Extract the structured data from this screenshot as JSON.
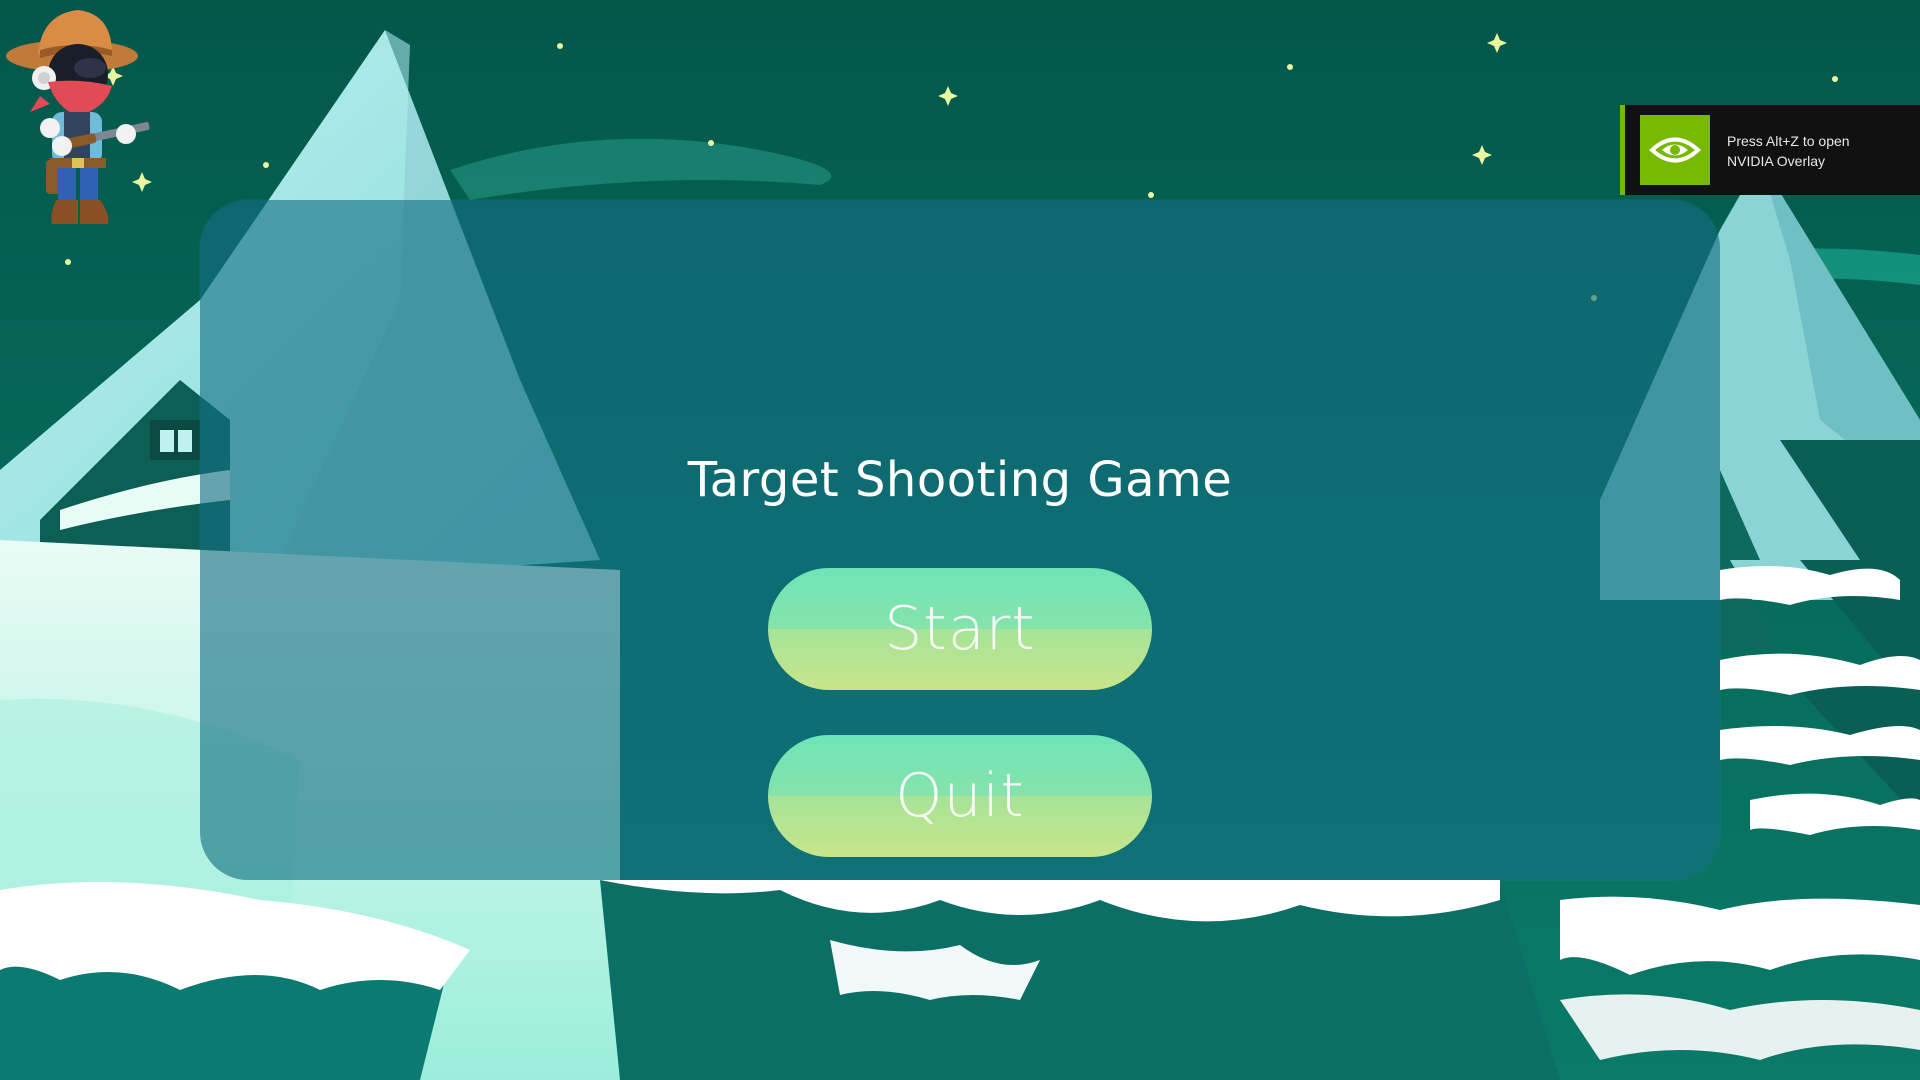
{
  "game": {
    "title": "Target Shooting Game"
  },
  "menu": {
    "start_label": "Start",
    "quit_label": "Quit"
  },
  "overlay": {
    "line1": "Press Alt+Z to open",
    "line2": "NVIDIA Overlay",
    "logo_icon": "nvidia-eye-icon"
  },
  "colors": {
    "sky": "#04584a",
    "panel": "#146e82",
    "button_top": "#6ee4b8",
    "button_bottom": "#c8e58a",
    "nvidia_green": "#76b900"
  }
}
